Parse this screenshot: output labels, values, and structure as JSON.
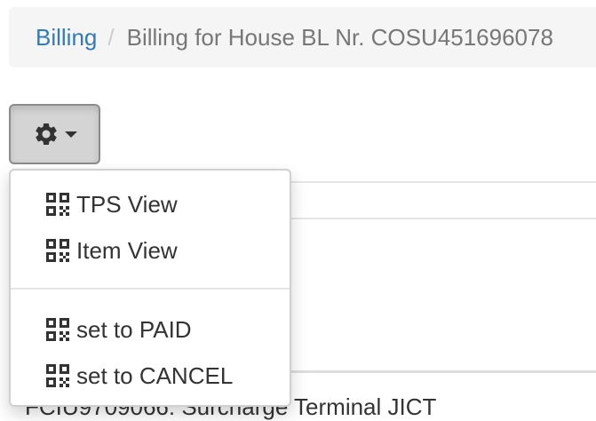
{
  "breadcrumb": {
    "parent_label": "Billing",
    "separator": "/",
    "current_label": "Billing for House BL Nr. COSU451696078"
  },
  "toolbar": {
    "gear_button_icon": "gear-icon",
    "caret_icon": "caret-down-icon"
  },
  "dropdown": {
    "items": [
      {
        "label": "TPS View",
        "icon": "qrcode-icon"
      },
      {
        "label": "Item View",
        "icon": "qrcode-icon"
      },
      {
        "label": "set to PAID",
        "icon": "qrcode-icon"
      },
      {
        "label": "set to CANCEL",
        "icon": "qrcode-icon"
      }
    ]
  },
  "background": {
    "partial_row_text": "FCIU9709066: Surcharge Terminal JICT"
  },
  "colors": {
    "link": "#337ab7",
    "breadcrumb_bg": "#f5f5f5",
    "button_active_bg": "#d4d4d4"
  }
}
